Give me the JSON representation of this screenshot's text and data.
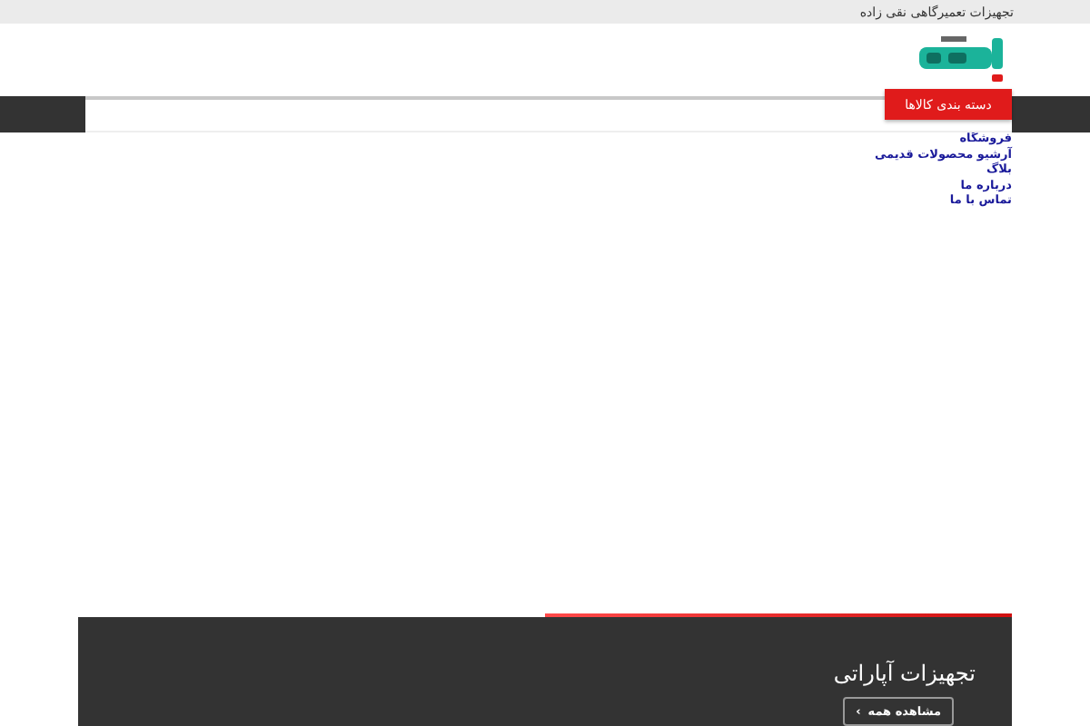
{
  "top_bar": {
    "text": "تجهیزات تعمیرگاهی نقی زاده"
  },
  "nav": {
    "category_button": "دسته بندی کالاها",
    "menu": [
      "فروشگاه",
      "آرشیو محصولات قدیمی",
      "بلاگ",
      "درباره ما",
      "تماس با ما"
    ]
  },
  "section": {
    "title": "تجهیزات آپاراتی",
    "button": "مشاهده همه",
    "button_icon": "›"
  }
}
